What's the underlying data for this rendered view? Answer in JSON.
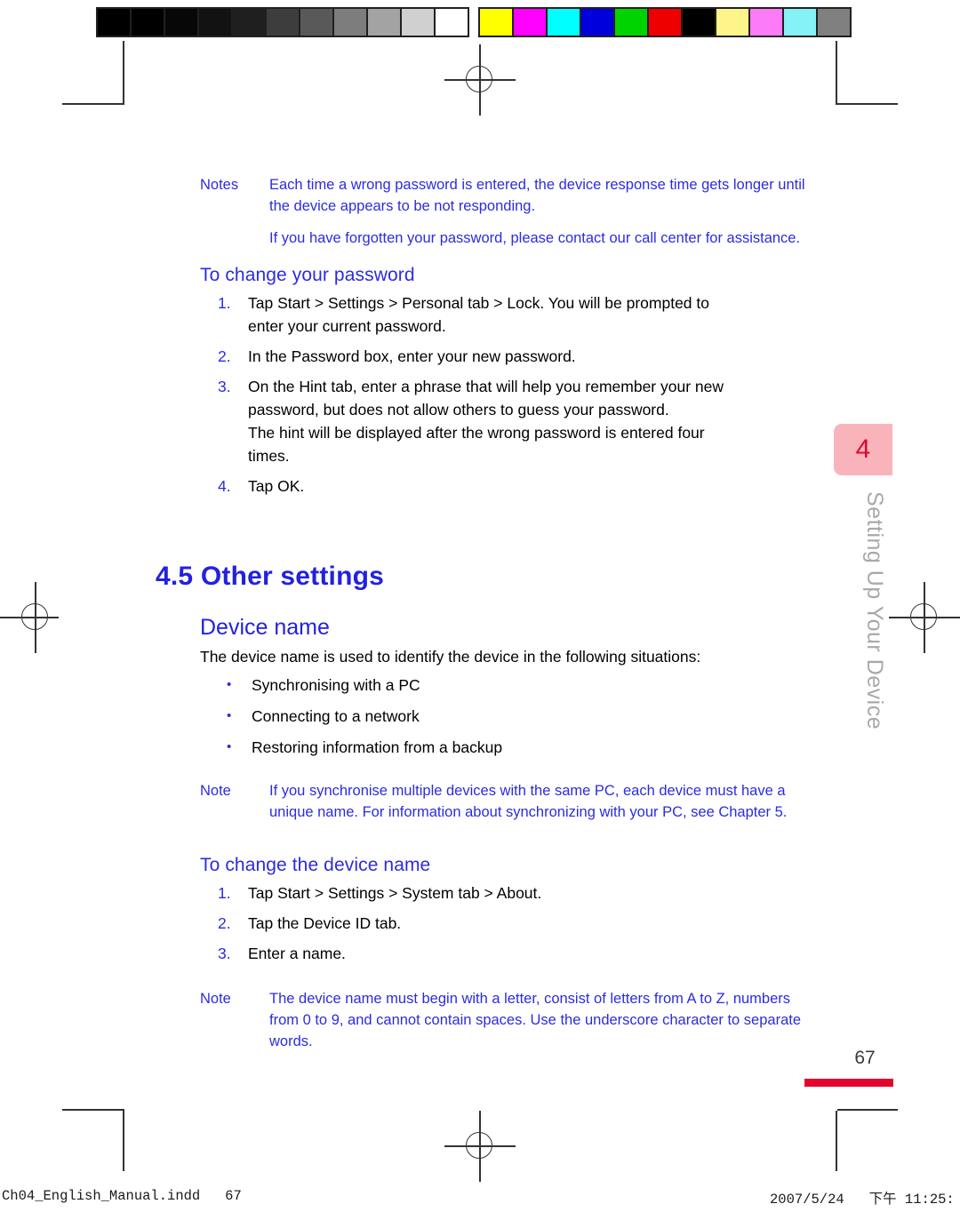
{
  "colors": {
    "heading_blue": "#2222DD",
    "note_blue": "#2C2CE0",
    "body_black": "#000000",
    "tab_pink": "#F9B4BB",
    "tab_red": "#E4052F",
    "rule_red": "#E4052F",
    "vertical_title_gray": "#A9A9A9"
  },
  "calibration_bar": {
    "grayscale": [
      "#000000",
      "#000000",
      "#070707",
      "#121212",
      "#1f1f1f",
      "#3d3d3d",
      "#595959",
      "#7d7d7d",
      "#a3a3a3",
      "#d0d0d0",
      "#ffffff"
    ],
    "colors": [
      "#ffff00",
      "#ff00ff",
      "#00ffff",
      "#0000dd",
      "#00d400",
      "#ee0000",
      "#000000",
      "#fdf58a",
      "#fb7cf6",
      "#85f2f7",
      "#808080"
    ]
  },
  "notes_top": {
    "label": "Notes",
    "paragraphs": [
      "Each time a wrong password is entered, the device response time gets longer until the device appears to be not responding.",
      "If you have forgotten your password, please contact our call center for assistance."
    ]
  },
  "change_password": {
    "heading": "To change your password",
    "steps": [
      {
        "num": "1.",
        "lines": [
          "Tap Start > Settings > Personal tab > Lock. You will be prompted to",
          "enter your current password."
        ]
      },
      {
        "num": "2.",
        "lines": [
          "In the Password box, enter your new password."
        ]
      },
      {
        "num": "3.",
        "lines": [
          "On the Hint tab, enter a phrase that will help you remember your new",
          "password, but does not allow others to guess your password.",
          "The hint will be displayed after the wrong password is entered four",
          "times."
        ]
      },
      {
        "num": "4.",
        "lines": [
          "Tap OK."
        ]
      }
    ]
  },
  "section": {
    "heading": "4.5 Other settings",
    "topic_heading": "Device name",
    "intro": "The device name is used to identify the device in the following situations:",
    "bullet_glyph": "•",
    "bullets": [
      "Synchronising with a PC",
      "Connecting to a network",
      "Restoring information from a backup"
    ]
  },
  "note_device": {
    "label": "Note",
    "paragraphs": [
      "If you synchronise multiple devices with the same PC, each device must have a unique name. For information about synchronizing with your PC, see Chapter 5."
    ]
  },
  "change_device_name": {
    "heading": "To change the device name",
    "steps": [
      {
        "num": "1.",
        "lines": [
          "Tap Start > Settings > System tab > About."
        ]
      },
      {
        "num": "2.",
        "lines": [
          "Tap the Device ID tab."
        ]
      },
      {
        "num": "3.",
        "lines": [
          "Enter a name."
        ]
      }
    ]
  },
  "note_naming": {
    "label": "Note",
    "paragraphs": [
      "The device name must begin with a letter, consist of letters from A to Z, numbers from 0 to 9, and cannot contain spaces. Use the underscore character to separate words."
    ]
  },
  "chapter_tab": {
    "number": "4",
    "vertical_title": "Setting Up Your Device"
  },
  "page_number": "67",
  "footer": {
    "left": "Ch04_English_Manual.indd   67",
    "right": "2007/5/24   下午 11:25:"
  }
}
